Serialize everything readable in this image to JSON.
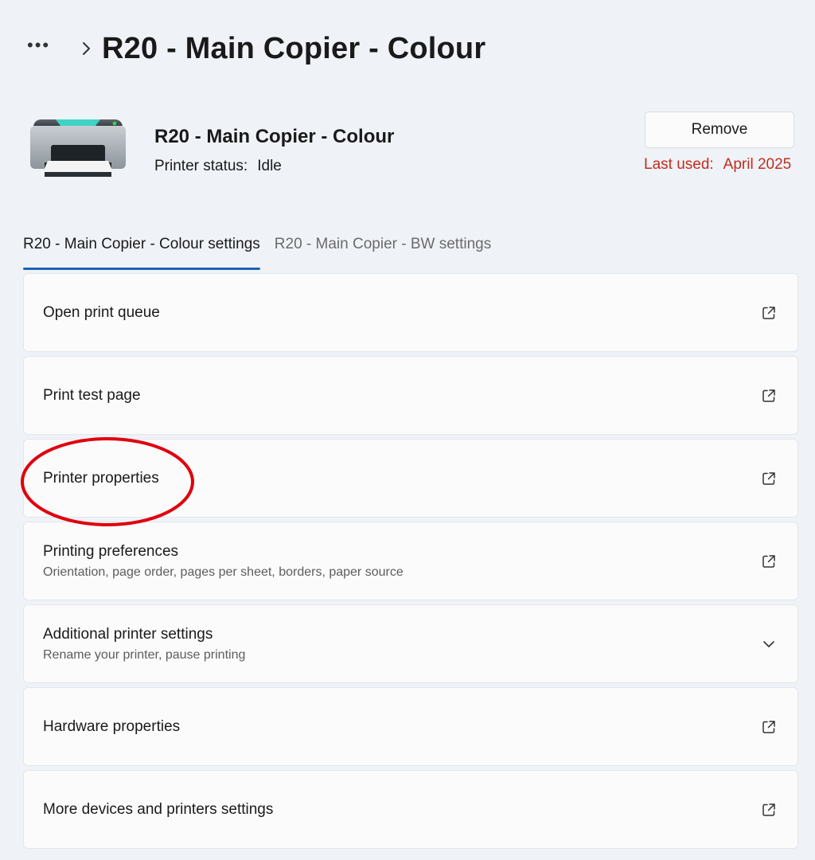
{
  "breadcrumb": {
    "more_label": "•••",
    "title": "R20 - Main Copier - Colour"
  },
  "printer": {
    "name": "R20 - Main Copier - Colour",
    "status_label": "Printer status:",
    "status_value": "Idle",
    "remove_label": "Remove",
    "last_used_label": "Last used:",
    "last_used_value": "April 2025"
  },
  "tabs": [
    {
      "label": "R20 - Main Copier - Colour settings",
      "active": true
    },
    {
      "label": "R20 - Main Copier - BW settings",
      "active": false
    }
  ],
  "rows": [
    {
      "label": "Open print queue",
      "description": "",
      "icon": "external-link-icon"
    },
    {
      "label": "Print test page",
      "description": "",
      "icon": "external-link-icon"
    },
    {
      "label": "Printer properties",
      "description": "",
      "icon": "external-link-icon"
    },
    {
      "label": "Printing preferences",
      "description": "Orientation, page order, pages per sheet, borders, paper source",
      "icon": "external-link-icon"
    },
    {
      "label": "Additional printer settings",
      "description": "Rename your printer, pause printing",
      "icon": "chevron-down-icon"
    },
    {
      "label": "Hardware properties",
      "description": "",
      "icon": "external-link-icon"
    },
    {
      "label": "More devices and printers settings",
      "description": "",
      "icon": "external-link-icon"
    }
  ],
  "colors": {
    "accent": "#1c63b8",
    "last_used": "#c42b1c",
    "annotation": "#e0000f"
  }
}
